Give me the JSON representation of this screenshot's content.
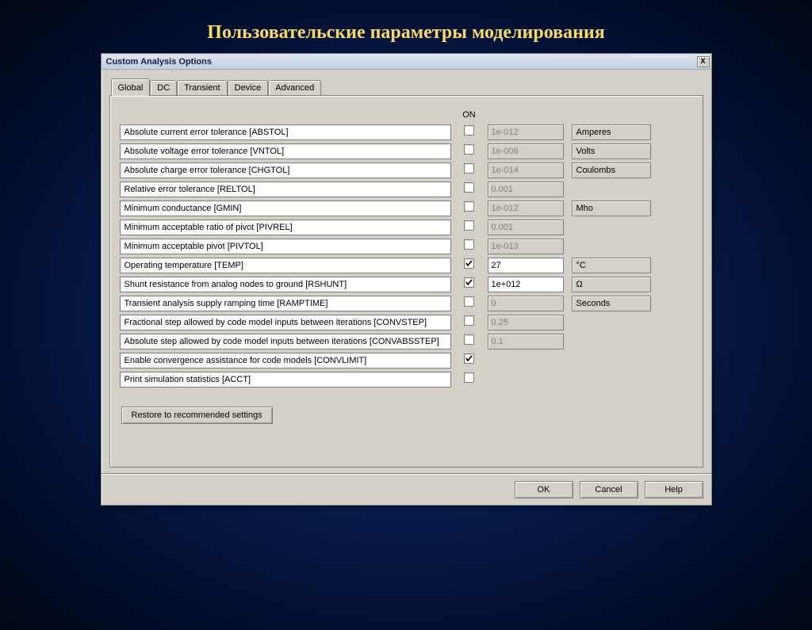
{
  "slide_title": "Пользовательские параметры моделирования",
  "window": {
    "title": "Custom Analysis Options",
    "close": "X"
  },
  "tabs": [
    "Global",
    "DC",
    "Transient",
    "Device",
    "Advanced"
  ],
  "active_tab": 0,
  "on_header": "ON",
  "params": [
    {
      "label": "Absolute current error tolerance [ABSTOL]",
      "checked": false,
      "value": "1e-012",
      "enabled": false,
      "unit": "Amperes"
    },
    {
      "label": "Absolute voltage error tolerance [VNTOL]",
      "checked": false,
      "value": "1e-006",
      "enabled": false,
      "unit": "Volts"
    },
    {
      "label": "Absolute charge error tolerance [CHGTOL]",
      "checked": false,
      "value": "1e-014",
      "enabled": false,
      "unit": "Coulombs"
    },
    {
      "label": "Relative error tolerance [RELTOL]",
      "checked": false,
      "value": "0.001",
      "enabled": false,
      "unit": ""
    },
    {
      "label": "Minimum conductance [GMIN]",
      "checked": false,
      "value": "1e-012",
      "enabled": false,
      "unit": "Mho"
    },
    {
      "label": "Minimum acceptable ratio of pivot [PIVREL]",
      "checked": false,
      "value": "0.001",
      "enabled": false,
      "unit": ""
    },
    {
      "label": "Minimum acceptable pivot [PIVTOL]",
      "checked": false,
      "value": "1e-013",
      "enabled": false,
      "unit": ""
    },
    {
      "label": "Operating temperature [TEMP]",
      "checked": true,
      "value": "27",
      "enabled": true,
      "unit": "°C"
    },
    {
      "label": "Shunt resistance from analog nodes to ground [RSHUNT]",
      "checked": true,
      "value": "1e+012",
      "enabled": true,
      "unit": "Ω"
    },
    {
      "label": "Transient analysis supply ramping time [RAMPTIME]",
      "checked": false,
      "value": "0",
      "enabled": false,
      "unit": "Seconds"
    },
    {
      "label": "Fractional step allowed by code model inputs between iterations [CONVSTEP]",
      "checked": false,
      "value": "0.25",
      "enabled": false,
      "unit": ""
    },
    {
      "label": "Absolute step allowed by code model inputs between iterations [CONVABSSTEP]",
      "checked": false,
      "value": "0.1",
      "enabled": false,
      "unit": ""
    },
    {
      "label": "Enable convergence assistance for code models [CONVLIMIT]",
      "checked": true,
      "value": null,
      "enabled": false,
      "unit": ""
    },
    {
      "label": "Print simulation statistics [ACCT]",
      "checked": false,
      "value": null,
      "enabled": false,
      "unit": ""
    }
  ],
  "restore_label": "Restore to recommended settings",
  "footer": {
    "ok": "OK",
    "cancel": "Cancel",
    "help": "Help"
  }
}
